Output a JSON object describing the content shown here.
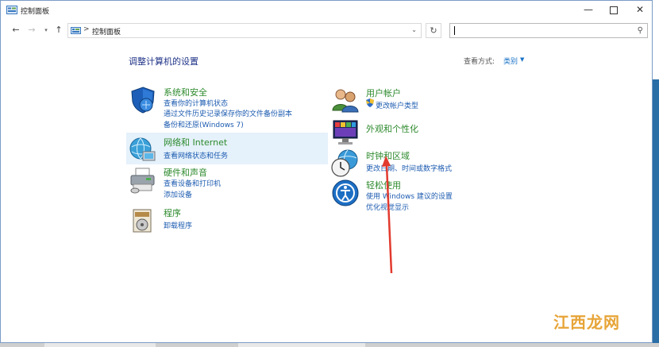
{
  "window": {
    "title": "控制面板"
  },
  "address": {
    "separator": ">",
    "crumb": "控制面板",
    "search_placeholder": ""
  },
  "main": {
    "heading": "调整计算机的设置",
    "view_by_label": "查看方式:",
    "view_by_value": "类别"
  },
  "categories_left": [
    {
      "title": "系统和安全",
      "icon": "shield-icon",
      "links": [
        "查看你的计算机状态",
        "通过文件历史记录保存你的文件备份副本",
        "备份和还原(Windows 7)"
      ]
    },
    {
      "title": "网络和 Internet",
      "icon": "network-globe-icon",
      "links": [
        "查看网络状态和任务"
      ]
    },
    {
      "title": "硬件和声音",
      "icon": "printer-icon",
      "links": [
        "查看设备和打印机",
        "添加设备"
      ]
    },
    {
      "title": "程序",
      "icon": "programs-icon",
      "links": [
        "卸载程序"
      ]
    }
  ],
  "categories_right": [
    {
      "title": "用户帐户",
      "icon": "users-icon",
      "links": [
        "更改帐户类型"
      ]
    },
    {
      "title": "外观和个性化",
      "icon": "display-icon",
      "links": []
    },
    {
      "title": "时钟和区域",
      "icon": "clock-globe-icon",
      "links": [
        "更改日期、时间或数字格式"
      ]
    },
    {
      "title": "轻松使用",
      "icon": "ease-of-access-icon",
      "links": [
        "使用 Windows 建议的设置",
        "优化视觉显示"
      ]
    }
  ],
  "watermark": {
    "text": "江西龙网"
  },
  "colors": {
    "category_title": "#2d8a2d",
    "link": "#1c5bb0",
    "heading": "#1e3287",
    "hover_highlight": "#e5f1fb",
    "annotation_arrow": "#e23a2e",
    "desktop": "#2b6ea6"
  }
}
